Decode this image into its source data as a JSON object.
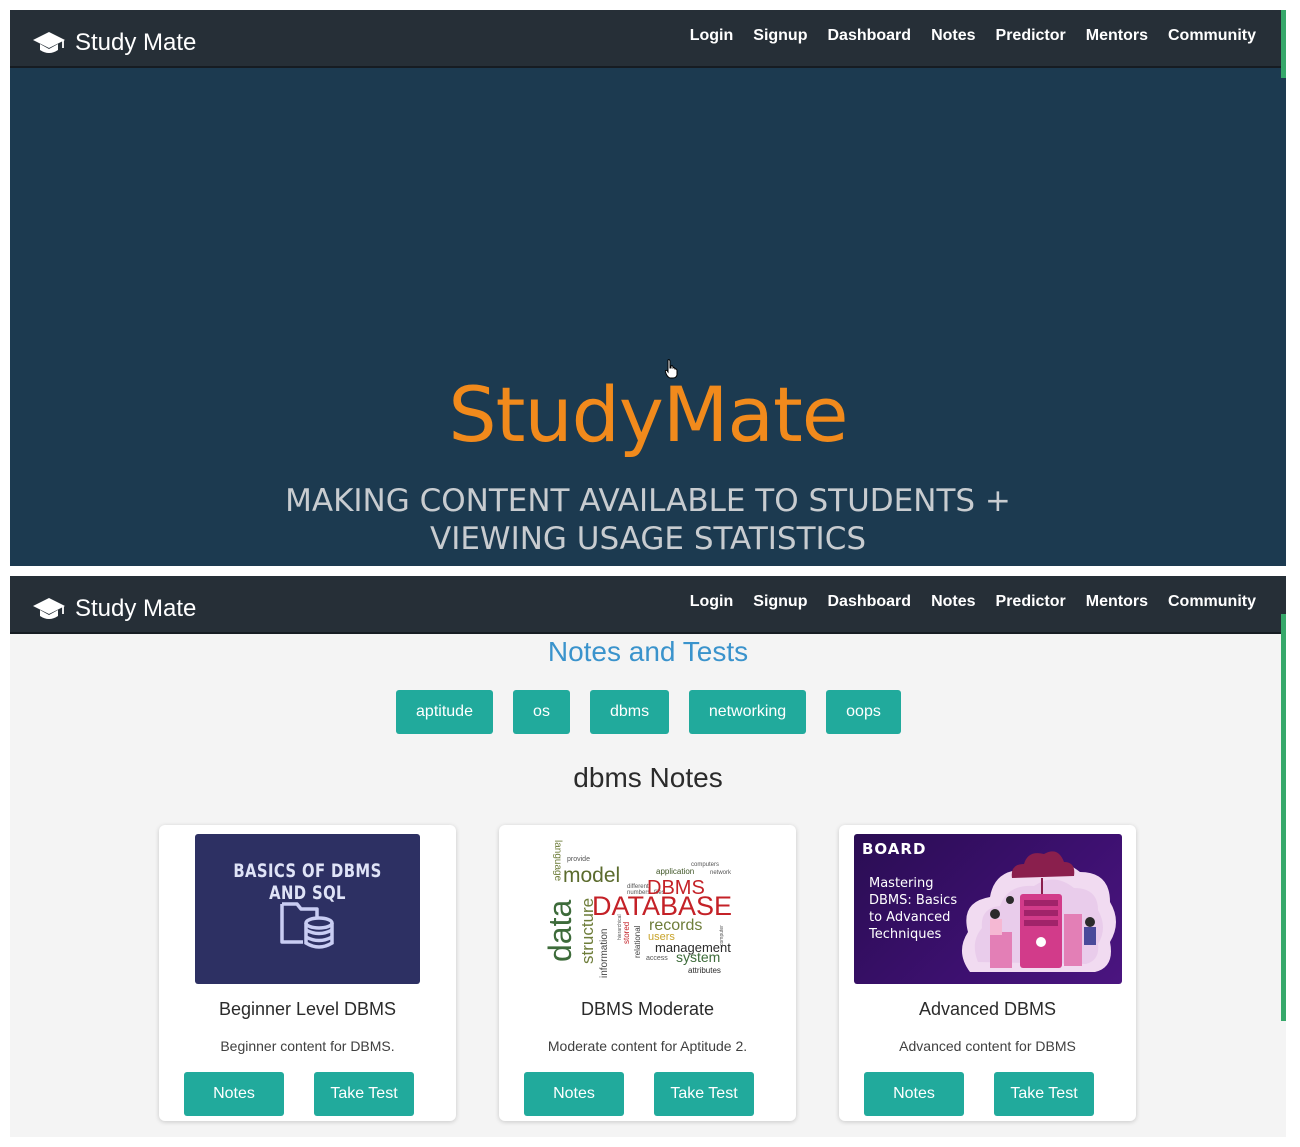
{
  "brand": {
    "name": "Study Mate"
  },
  "nav": {
    "links": [
      "Login",
      "Signup",
      "Dashboard",
      "Notes",
      "Predictor",
      "Mentors",
      "Community"
    ]
  },
  "hero": {
    "title": "StudyMate",
    "subtitle_line1": "MAKING CONTENT AVAILABLE TO STUDENTS +",
    "subtitle_line2": "VIEWING USAGE STATISTICS"
  },
  "notes_page": {
    "title": "Notes and Tests",
    "categories": [
      "aptitude",
      "os",
      "dbms",
      "networking",
      "oops"
    ],
    "selected_heading": "dbms Notes",
    "cards": [
      {
        "title": "Beginner Level DBMS",
        "description": "Beginner content for DBMS.",
        "image_text": "BASICS OF DBMS AND SQL",
        "image_icon": "folder-database-icon",
        "notes_label": "Notes",
        "test_label": "Take Test"
      },
      {
        "title": "DBMS Moderate",
        "description": "Moderate content for Aptitude 2.",
        "image_words": [
          "model",
          "DBMS",
          "DATABASE",
          "data",
          "system",
          "management",
          "records",
          "users",
          "structure",
          "information",
          "language",
          "application",
          "attributes",
          "relational",
          "stored",
          "access",
          "computers",
          "network",
          "provide",
          "numbers",
          "files",
          "different",
          "hierarchical",
          "computer"
        ],
        "notes_label": "Notes",
        "test_label": "Take Test"
      },
      {
        "title": "Advanced DBMS",
        "description": "Advanced content for DBMS",
        "image_logo": "BOARD",
        "image_text_lines": [
          "Mastering",
          "DBMS: Basics",
          "to Advanced",
          "Techniques"
        ],
        "notes_label": "Notes",
        "test_label": "Take Test"
      }
    ]
  },
  "colors": {
    "navbar": "#262f37",
    "hero_bg": "#1c3a50",
    "hero_title": "#f18a1c",
    "accent_teal": "#21aa9c",
    "section_title": "#3a93cc"
  }
}
